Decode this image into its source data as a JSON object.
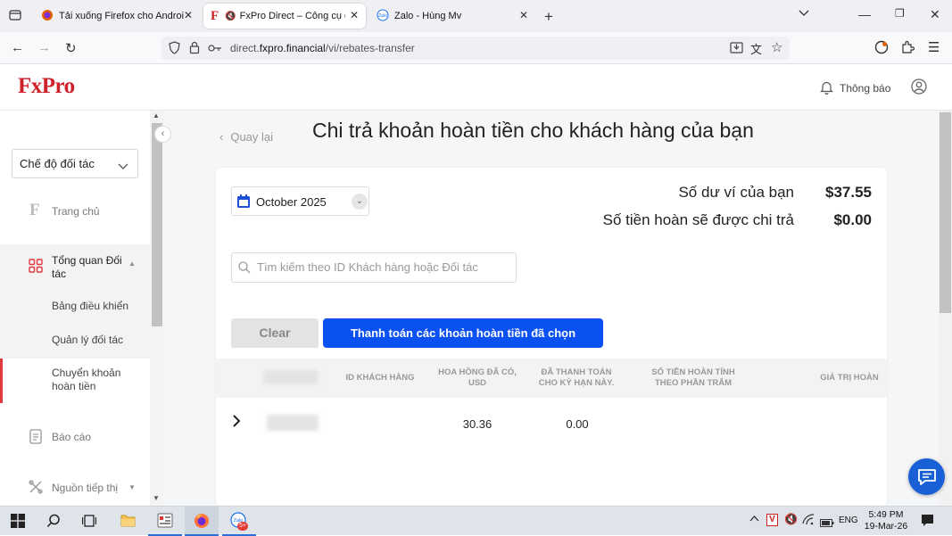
{
  "browser": {
    "tabs": [
      {
        "title": "Tải xuống Firefox cho Android v",
        "active": false
      },
      {
        "title": "FxPro Direct – Công cụ quả",
        "active": true
      },
      {
        "title": "Zalo - Hùng Mv",
        "active": false
      }
    ],
    "url_prefix": "direct.",
    "url_host": "fxpro.financial",
    "url_path": "/vi/rebates-transfer"
  },
  "header": {
    "logo": "FxPro",
    "notifications_label": "Thông báo"
  },
  "sidebar": {
    "partner_mode": "Chế độ đối tác",
    "home": "Trang chủ",
    "overview": "Tổng quan Đối tác",
    "dashboard": "Bảng điều khiển",
    "manage_partners": "Quản lý đối tác",
    "rebate_transfer": "Chuyển khoản hoàn tiền",
    "reports": "Báo cáo",
    "marketing_tools": "Nguồn tiếp thị"
  },
  "main": {
    "back_label": "Quay lại",
    "title": "Chi trả khoản hoàn tiền cho khách hàng của bạn",
    "month": "October 2025",
    "wallet_balance_label": "Số dư ví của bạn",
    "wallet_balance_value": "$37.55",
    "rebate_payout_label": "Số tiền hoàn sẽ được chi trả",
    "rebate_payout_value": "$0.00",
    "search_placeholder": "Tìm kiếm theo ID Khách hàng hoặc Đối tác",
    "clear_button": "Clear",
    "pay_button": "Thanh toán các khoản hoàn tiền đã chọn",
    "table": {
      "headers": {
        "client_id": "ID KHÁCH HÀNG",
        "commission": "HOA HỒNG ĐÃ CÓ, USD",
        "paid": "ĐÃ THANH TOÁN CHO KỲ HẠN NÀY.",
        "percent_rebate": "SỐ TIỀN HOÀN TÍNH THEO PHẦN TRĂM",
        "rebate_value": "GIÁ TRỊ HOÀN"
      },
      "rows": [
        {
          "commission": "30.36",
          "paid": "0.00"
        }
      ]
    }
  },
  "taskbar": {
    "lang": "ENG",
    "time": "5:49 PM",
    "date": "19-Mar-26",
    "badge": "5+"
  }
}
